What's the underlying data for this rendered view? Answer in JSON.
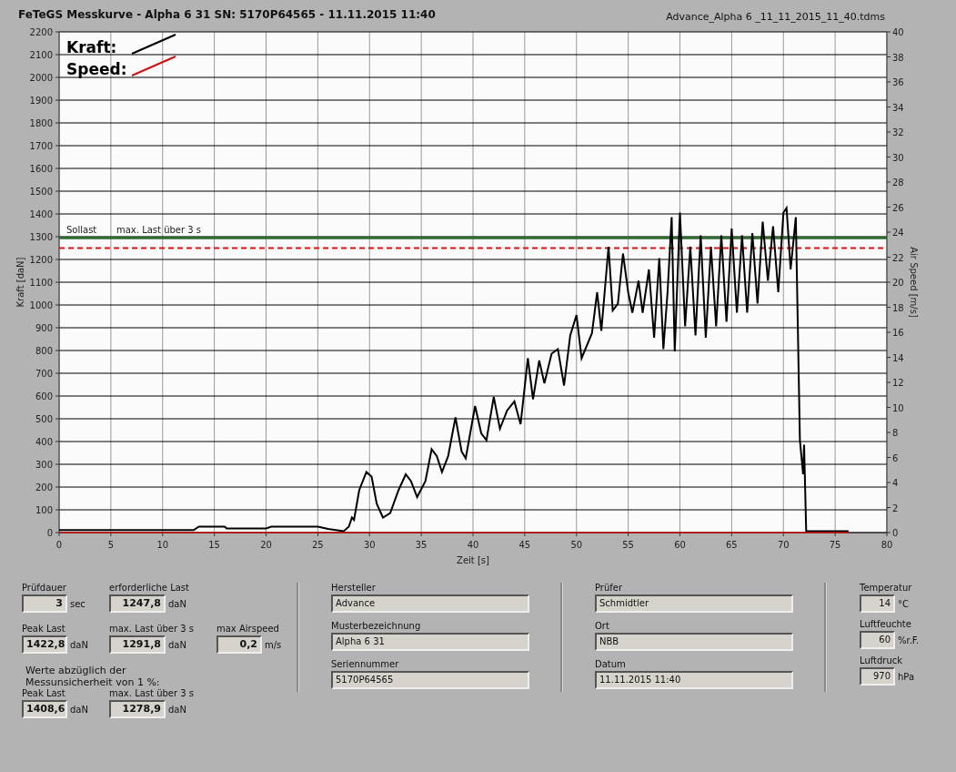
{
  "header": {
    "title": "FeTeGS Messkurve - Alpha 6 31  SN: 5170P64565 - 11.11.2015 11:40",
    "file": "Advance_Alpha 6 _11_11_2015_11_40.tdms"
  },
  "chart_data": {
    "type": "line",
    "xlabel": "Zeit [s]",
    "ylabel": "Kraft [daN]",
    "xlim": [
      0,
      80
    ],
    "ylim": [
      0,
      2200
    ],
    "xticks": [
      0,
      5,
      10,
      15,
      20,
      25,
      30,
      35,
      40,
      45,
      50,
      55,
      60,
      65,
      70,
      75,
      80
    ],
    "yticks": [
      0,
      100,
      200,
      300,
      400,
      500,
      600,
      700,
      800,
      900,
      1000,
      1100,
      1200,
      1300,
      1400,
      1500,
      1600,
      1700,
      1800,
      1900,
      2000,
      2100,
      2200
    ],
    "series": [
      {
        "name": "Kraft:",
        "color": "#000000",
        "x": [
          0,
          13,
          13.5,
          16,
          16.2,
          20,
          20.5,
          25,
          26,
          27.5,
          28,
          28.3,
          28.5,
          29,
          29.7,
          30.2,
          30.7,
          31.3,
          32,
          32.8,
          33.5,
          34,
          34.6,
          35.4,
          36,
          36.5,
          37,
          37.6,
          38.3,
          38.9,
          39.3,
          40.2,
          40.8,
          41.3,
          42,
          42.6,
          43.3,
          44,
          44.6,
          45.3,
          45.8,
          46.4,
          46.9,
          47.6,
          48.2,
          48.8,
          49.4,
          50,
          50.5,
          51.5,
          52,
          52.4,
          53.1,
          53.5,
          54,
          54.5,
          55,
          55.4,
          56,
          56.4,
          57,
          57.5,
          58,
          58.4,
          58.8,
          59.2,
          59.5,
          60,
          60.5,
          61,
          61.5,
          62,
          62.5,
          63,
          63.5,
          64,
          64.5,
          65,
          65.5,
          66,
          66.5,
          67,
          67.5,
          68,
          68.5,
          69,
          69.5,
          70,
          70.3,
          70.7,
          71.2,
          71.6,
          71.9,
          72,
          72.2,
          76.3
        ],
        "values": [
          5,
          5,
          20,
          20,
          12,
          12,
          20,
          20,
          10,
          0,
          20,
          60,
          50,
          180,
          260,
          240,
          120,
          60,
          80,
          180,
          250,
          220,
          150,
          220,
          360,
          330,
          260,
          330,
          500,
          350,
          320,
          550,
          430,
          400,
          590,
          450,
          530,
          570,
          470,
          760,
          580,
          750,
          650,
          780,
          800,
          640,
          860,
          950,
          760,
          870,
          1050,
          880,
          1250,
          970,
          1000,
          1220,
          1050,
          960,
          1100,
          960,
          1150,
          850,
          1200,
          800,
          1050,
          1380,
          790,
          1400,
          900,
          1250,
          860,
          1300,
          850,
          1250,
          900,
          1300,
          920,
          1330,
          960,
          1300,
          960,
          1310,
          1000,
          1360,
          1100,
          1340,
          1050,
          1400,
          1420,
          1150,
          1380,
          400,
          250,
          380,
          0,
          0
        ]
      },
      {
        "name": "Speed:",
        "color": "#cc1111",
        "x": [
          0,
          76.3
        ],
        "values": [
          0,
          0
        ]
      }
    ],
    "grid": true,
    "legend": true,
    "ref_lines": [
      {
        "axis": "y",
        "value": 1250,
        "label": "Sollast",
        "color": "#dd1111"
      },
      {
        "axis": "y",
        "value": 1295,
        "label": "max. Last über  3 s",
        "color": "#2e6b2e"
      }
    ]
  },
  "right_axis": {
    "label": "Air Speed [m/s]",
    "ticks": [
      "40",
      "38",
      "36",
      "34",
      "32",
      "30",
      "28",
      "26",
      "24",
      "22",
      "20",
      "18",
      "16",
      "14",
      "12",
      "10",
      "8",
      "6",
      "4",
      "2",
      "0"
    ]
  },
  "results": {
    "rows": [
      [
        {
          "label": "Prüfdauer",
          "value": "3",
          "unit": "sec"
        },
        {
          "label": "erforderliche Last",
          "value": "1247,8",
          "unit": "daN"
        }
      ],
      [
        {
          "label": "Peak Last",
          "value": "1422,8",
          "unit": "daN"
        },
        {
          "label": "max. Last über  3 s",
          "value": "1291,8",
          "unit": "daN"
        },
        {
          "label": "max Airspeed",
          "value": "0,2",
          "unit": "m/s"
        }
      ]
    ],
    "note_lines": [
      "Werte abzüglich der",
      "Messunsicherheit von 1  %:"
    ],
    "corrected": [
      {
        "label": "Peak Last",
        "value": "1408,6",
        "unit": "daN"
      },
      {
        "label": "max. Last über  3 s",
        "value": "1278,9",
        "unit": "daN"
      }
    ]
  },
  "info_columns": [
    [
      {
        "label": "Hersteller",
        "value": "Advance"
      },
      {
        "label": "Musterbezeichnung",
        "value": "Alpha 6 31"
      },
      {
        "label": "Seriennummer",
        "value": "5170P64565"
      }
    ],
    [
      {
        "label": "Prüfer",
        "value": "Schmidtler"
      },
      {
        "label": "Ort",
        "value": "NBB"
      },
      {
        "label": "Datum",
        "value": "11.11.2015 11:40"
      }
    ]
  ],
  "environment": [
    {
      "label": "Temperatur",
      "value": "14",
      "unit": "°C"
    },
    {
      "label": "Luftfeuchte",
      "value": "60",
      "unit": "%r.F."
    },
    {
      "label": "Luftdruck",
      "value": "970",
      "unit": "hPa"
    }
  ]
}
